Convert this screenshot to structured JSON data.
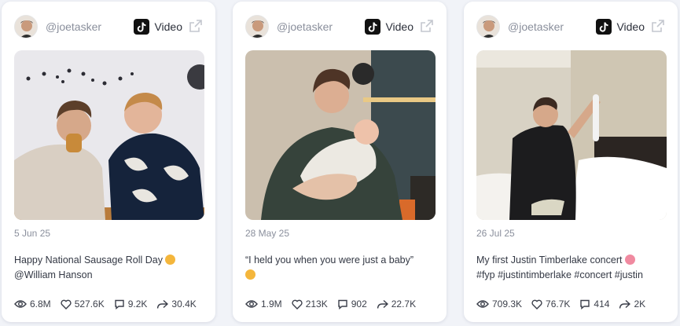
{
  "cards": [
    {
      "handle": "@joetasker",
      "type_label": "Video",
      "date": "5 Jun 25",
      "caption_line1": "Happy National Sausage Roll Day",
      "caption_line2": "@William Hanson",
      "stats": {
        "views": "6.8M",
        "likes": "527.6K",
        "comments": "9.2K",
        "shares": "30.4K"
      }
    },
    {
      "handle": "@joetasker",
      "type_label": "Video",
      "date": "28 May 25",
      "caption_line1": "“I held you when you were just a baby”",
      "caption_line2": "",
      "stats": {
        "views": "1.9M",
        "likes": "213K",
        "comments": "902",
        "shares": "22.7K"
      }
    },
    {
      "handle": "@joetasker",
      "type_label": "Video",
      "date": "26 Jul 25",
      "caption_line1": "My first Justin Timberlake concert",
      "caption_line2": "#fyp #justintimberlake #concert #justin",
      "stats": {
        "views": "709.3K",
        "likes": "76.7K",
        "comments": "414",
        "shares": "2K"
      }
    }
  ],
  "icons": {
    "platform": "tiktok-icon",
    "external": "external-link-icon",
    "views": "eye-icon",
    "likes": "heart-icon",
    "comments": "comment-icon",
    "shares": "share-icon"
  }
}
